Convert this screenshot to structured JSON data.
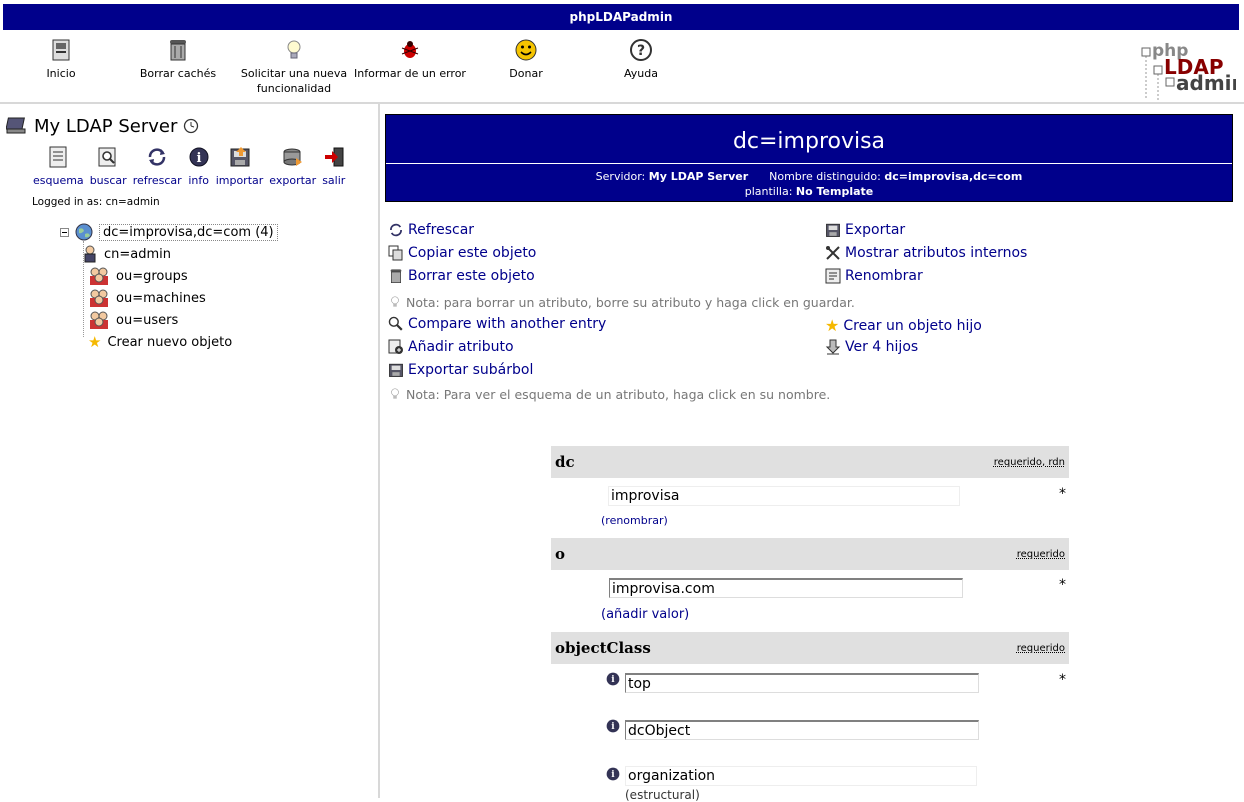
{
  "app_title": "phpLDAPadmin",
  "toolbar": [
    {
      "label": "Inicio",
      "icon": "home-icon"
    },
    {
      "label": "Borrar cachés",
      "icon": "trash-icon"
    },
    {
      "label": "Solicitar una nueva funcionalidad",
      "icon": "lightbulb-icon"
    },
    {
      "label": "Informar de un error",
      "icon": "bug-icon"
    },
    {
      "label": "Donar",
      "icon": "smiley-icon"
    },
    {
      "label": "Ayuda",
      "icon": "help-icon"
    }
  ],
  "logo": {
    "php": "php",
    "ldap": "LDAP",
    "admin": "admin"
  },
  "server": {
    "name": "My LDAP Server",
    "tools": [
      "esquema",
      "buscar",
      "refrescar",
      "info",
      "importar",
      "exportar",
      "salir"
    ],
    "logged_in": "Logged in as: cn=admin"
  },
  "tree": {
    "root": "dc=improvisa,dc=com (4)",
    "children": [
      "cn=admin",
      "ou=groups",
      "ou=machines",
      "ou=users"
    ],
    "create": "Crear nuevo objeto"
  },
  "entry": {
    "dn_title": "dc=improvisa",
    "server_label": "Servidor:",
    "server_value": "My LDAP Server",
    "dn_label": "Nombre distinguido:",
    "dn_value": "dc=improvisa,dc=com",
    "template_label": "plantilla:",
    "template_value": "No Template"
  },
  "actions": {
    "refresh": "Refrescar",
    "copy": "Copiar este objeto",
    "delete": "Borrar este objeto",
    "note_delete": "Nota: para borrar un atributo, borre su atributo y haga click en guardar.",
    "compare": "Compare with another entry",
    "add_attr": "Añadir atributo",
    "export_subtree": "Exportar subárbol",
    "note_schema": "Nota: Para ver el esquema de un atributo, haga click en su nombre.",
    "export": "Exportar",
    "show_internal": "Mostrar atributos internos",
    "rename": "Renombrar",
    "create_child": "Crear un objeto hijo",
    "view_children": "Ver 4 hijos"
  },
  "attributes": {
    "dc": {
      "name": "dc",
      "flags": "requerido, rdn",
      "value": "improvisa",
      "link": "(renombrar)"
    },
    "o": {
      "name": "o",
      "flags": "requerido",
      "value": "improvisa.com",
      "link_prefix": "(",
      "link": "añadir valor",
      "link_suffix": ")"
    },
    "objectclass": {
      "name": "objectClass",
      "flags": "requerido",
      "values": [
        "top",
        "dcObject",
        "organization"
      ],
      "structural": "(estructural)"
    }
  },
  "required_mark": "*"
}
